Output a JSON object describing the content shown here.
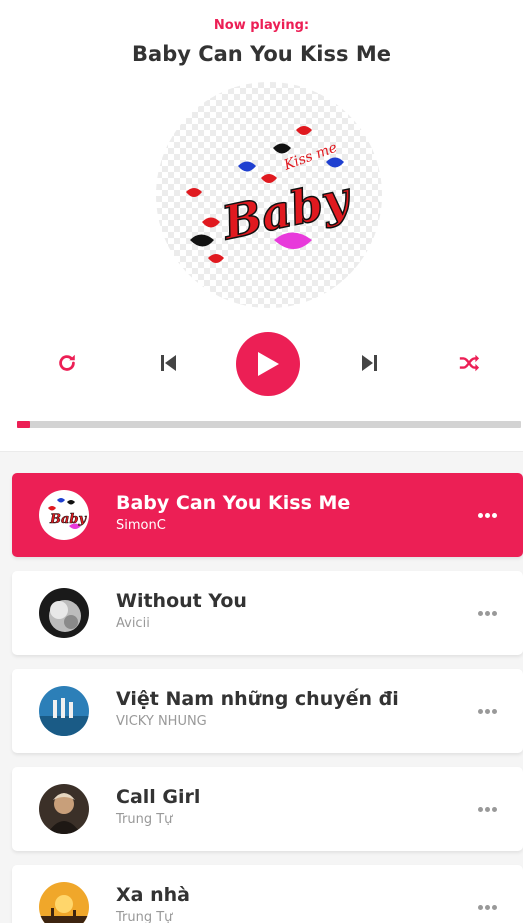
{
  "player": {
    "now_playing_label": "Now playing:",
    "current_song_title": "Baby Can You Kiss Me",
    "progress_percent": 2.5,
    "accent_color": "#ec1f55"
  },
  "controls": {
    "repeat_icon": "repeat-icon",
    "prev_icon": "skip-back-icon",
    "play_icon": "play-icon",
    "next_icon": "skip-forward-icon",
    "random_icon": "shuffle-icon"
  },
  "playlist": [
    {
      "title": "Baby Can You Kiss Me",
      "author": "SimonC",
      "active": true
    },
    {
      "title": "Without You",
      "author": "Avicii",
      "active": false
    },
    {
      "title": "Việt Nam những chuyến đi",
      "author": "VICKY NHUNG",
      "active": false
    },
    {
      "title": "Call Girl",
      "author": "Trung Tự",
      "active": false
    },
    {
      "title": "Xa nhà",
      "author": "Trung Tự",
      "active": false
    }
  ],
  "cover_lettering": {
    "main": "Baby",
    "script": "Kiss me"
  }
}
